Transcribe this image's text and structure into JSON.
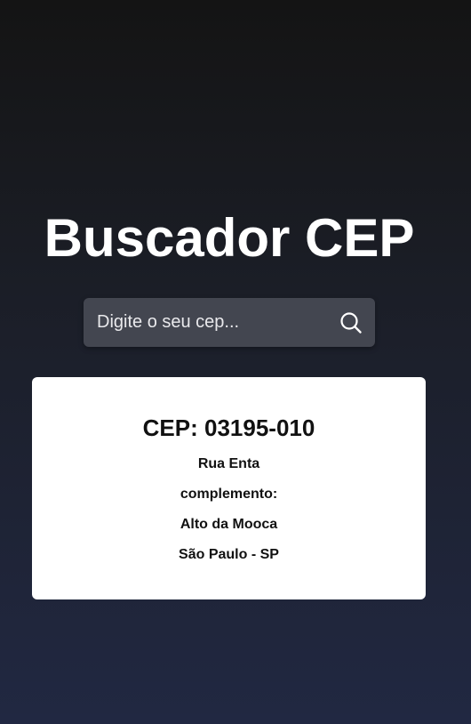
{
  "header": {
    "title": "Buscador CEP"
  },
  "search": {
    "placeholder": "Digite o seu cep...",
    "value": "",
    "icon": "search-icon"
  },
  "result": {
    "cep_label": "CEP: 03195-010",
    "street": "Rua Enta",
    "complement": "complemento:",
    "neighborhood": "Alto da Mooca",
    "city_state": "São Paulo - SP"
  },
  "colors": {
    "background_top": "#141414",
    "background_bottom": "#212842",
    "search_bg": "#434650",
    "card_bg": "#ffffff",
    "text_light": "#ffffff",
    "text_dark": "#111111"
  }
}
